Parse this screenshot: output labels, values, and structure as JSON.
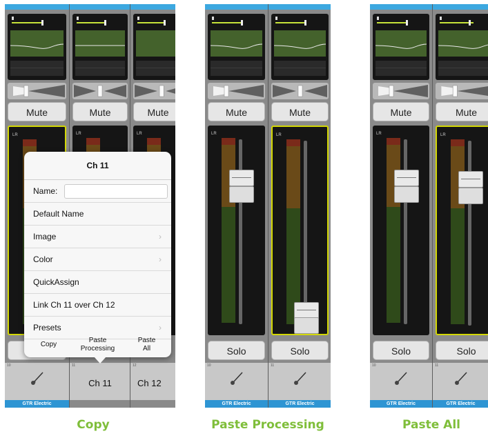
{
  "panels": [
    {
      "caption": "Copy",
      "strips": [
        {
          "mute": "Mute",
          "selected": true,
          "chnum": "10",
          "footer": "GTR Electric",
          "chname": ""
        },
        {
          "mute": "Mute",
          "selected": false,
          "chnum": "11",
          "footer": "",
          "chname": "Ch 11"
        },
        {
          "mute": "Mute",
          "selected": false,
          "chnum": "12",
          "footer": "",
          "chname": "Ch 12"
        }
      ]
    },
    {
      "caption": "Paste Processing",
      "strips": [
        {
          "mute": "Mute",
          "solo": "Solo",
          "selected": false,
          "chnum": "10",
          "footer": "GTR Electric"
        },
        {
          "mute": "Mute",
          "solo": "Solo",
          "selected": true,
          "chnum": "11",
          "footer": "GTR Electric"
        }
      ]
    },
    {
      "caption": "Paste All",
      "strips": [
        {
          "mute": "Mute",
          "solo": "Solo",
          "selected": false,
          "chnum": "10",
          "footer": "GTR Electric"
        },
        {
          "mute": "Mute",
          "solo": "Solo",
          "selected": true,
          "chnum": "11",
          "footer": "GTR Electric"
        }
      ]
    }
  ],
  "meter": {
    "lr_label": "LR"
  },
  "popover": {
    "title": "Ch 11",
    "name_label": "Name:",
    "name_value": "",
    "items": [
      {
        "label": "Default Name",
        "arrow": ""
      },
      {
        "label": "Image",
        "arrow": "›"
      },
      {
        "label": "Color",
        "arrow": "›"
      },
      {
        "label": "QuickAssign",
        "arrow": ""
      },
      {
        "label": "Link Ch 11 over Ch 12",
        "arrow": ""
      },
      {
        "label": "Presets",
        "arrow": "›"
      }
    ],
    "copy": "Copy",
    "paste_processing": "Paste Processing",
    "paste_all": "Paste All"
  },
  "colors": {
    "accent_blue": "#3ca8e0",
    "select_yellow": "#d4d800",
    "caption_green": "#7fbe3a"
  }
}
